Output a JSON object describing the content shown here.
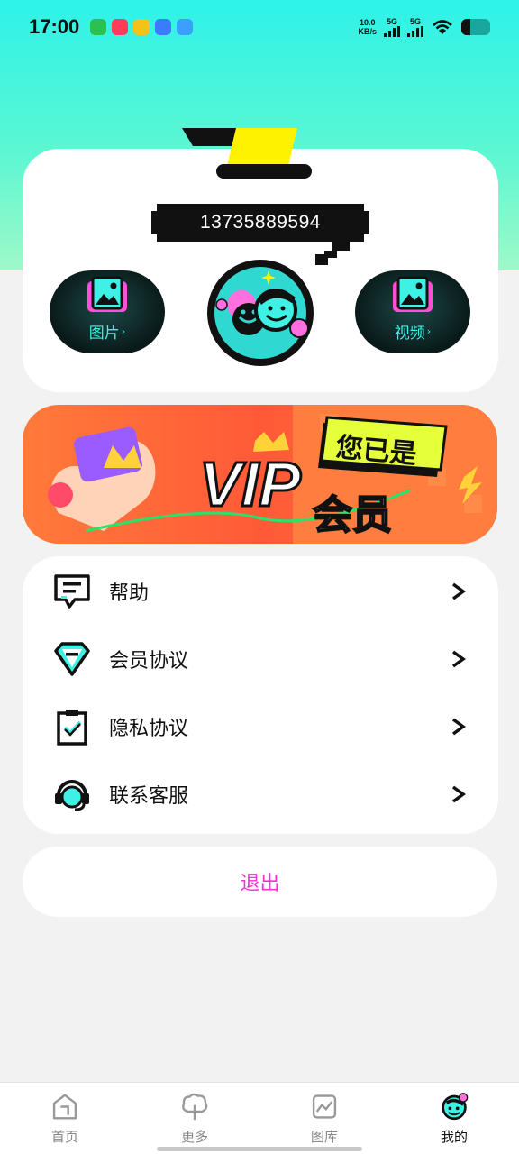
{
  "status_bar": {
    "time": "17:00",
    "net_speed_value": "10.0",
    "net_speed_unit": "KB/s",
    "signal_1_label": "5G",
    "signal_2_label": "5G",
    "app_icons": [
      "wechat-icon",
      "video-app-icon",
      "wallet-app-icon",
      "browser-app-icon",
      "mail-app-icon"
    ],
    "app_colors": [
      "#2bc04f",
      "#ff3b5c",
      "#f5c11b",
      "#3b7bff",
      "#3aa0ff"
    ]
  },
  "profile": {
    "phone": "13735889594",
    "left_button_label": "图片",
    "right_button_label": "视频",
    "avatar_icon": "smiley-avatar-icon"
  },
  "vip_banner": {
    "title_vip": "VIP",
    "title_member": "会员",
    "badge_text": "您已是"
  },
  "menu": {
    "items": [
      {
        "label": "帮助",
        "icon": "help-chat-icon"
      },
      {
        "label": "会员协议",
        "icon": "diamond-icon"
      },
      {
        "label": "隐私协议",
        "icon": "clipboard-check-icon"
      },
      {
        "label": "联系客服",
        "icon": "headset-icon"
      }
    ]
  },
  "logout": {
    "label": "退出"
  },
  "bottom_nav": {
    "items": [
      {
        "label": "首页",
        "icon": "home-icon",
        "active": false
      },
      {
        "label": "更多",
        "icon": "tree-icon",
        "active": false
      },
      {
        "label": "图库",
        "icon": "gallery-icon",
        "active": false
      },
      {
        "label": "我的",
        "icon": "profile-face-icon",
        "active": true
      }
    ]
  },
  "colors": {
    "accent_cyan": "#2ef2e8",
    "logout_pink": "#ff2fd3",
    "vip_orange": "#ff5a38",
    "deco_yellow": "#fff200"
  }
}
